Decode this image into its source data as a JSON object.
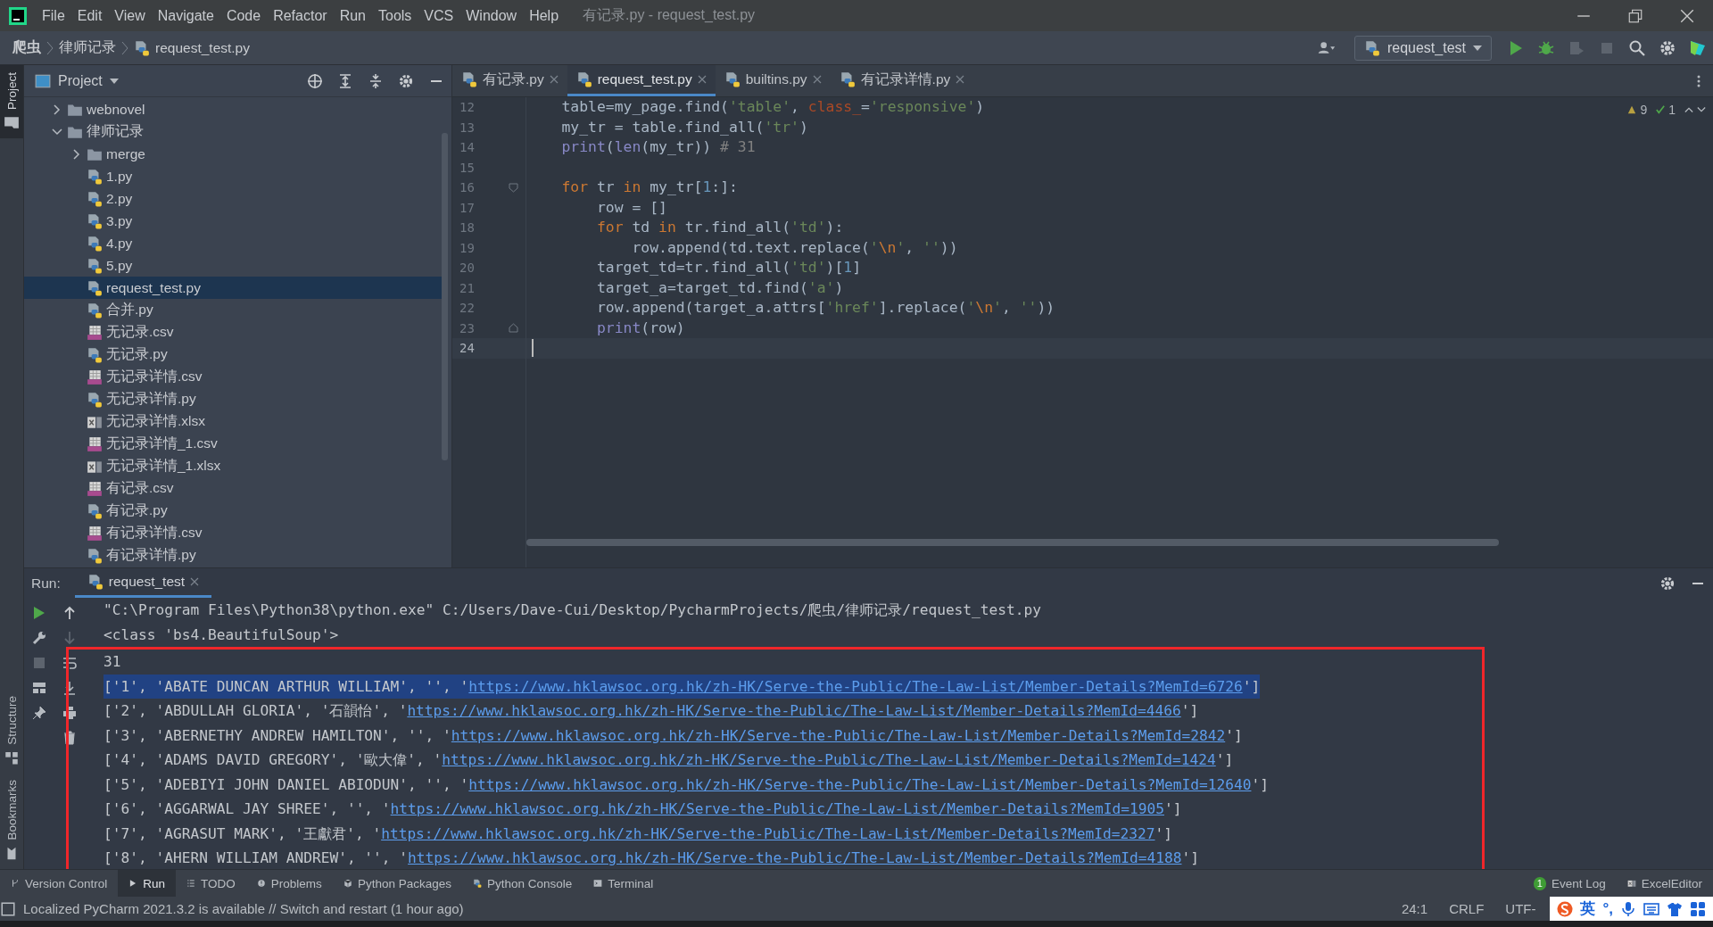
{
  "title_bar": {
    "menu": [
      "File",
      "Edit",
      "View",
      "Navigate",
      "Code",
      "Refactor",
      "Run",
      "Tools",
      "VCS",
      "Window",
      "Help"
    ],
    "title": "有记录.py - request_test.py"
  },
  "nav_bar": {
    "breadcrumbs": [
      "爬虫",
      "律师记录",
      "request_test.py"
    ],
    "run_config": "request_test"
  },
  "side_tabs": [
    {
      "label": "Project",
      "selected": true
    }
  ],
  "bottom_side_tabs": [
    {
      "label": "Structure",
      "selected": false
    },
    {
      "label": "Bookmarks",
      "selected": false
    }
  ],
  "project": {
    "title": "Project",
    "tree": [
      {
        "name": "webnovel",
        "kind": "folder",
        "expanded": false,
        "selected": false
      },
      {
        "name": "律师记录",
        "kind": "folder",
        "expanded": true,
        "selected": false,
        "children": [
          {
            "name": "merge",
            "kind": "folder",
            "expanded": false,
            "selected": false
          },
          {
            "name": "1.py",
            "kind": "python",
            "selected": false
          },
          {
            "name": "2.py",
            "kind": "python",
            "selected": false
          },
          {
            "name": "3.py",
            "kind": "python",
            "selected": false
          },
          {
            "name": "4.py",
            "kind": "python",
            "selected": false
          },
          {
            "name": "5.py",
            "kind": "python",
            "selected": false
          },
          {
            "name": "request_test.py",
            "kind": "python",
            "selected": true
          },
          {
            "name": "合并.py",
            "kind": "python",
            "selected": false
          },
          {
            "name": "无记录.csv",
            "kind": "csv",
            "selected": false
          },
          {
            "name": "无记录.py",
            "kind": "python",
            "selected": false
          },
          {
            "name": "无记录详情.csv",
            "kind": "csv",
            "selected": false
          },
          {
            "name": "无记录详情.py",
            "kind": "python",
            "selected": false
          },
          {
            "name": "无记录详情.xlsx",
            "kind": "excel",
            "selected": false
          },
          {
            "name": "无记录详情_1.csv",
            "kind": "csv",
            "selected": false
          },
          {
            "name": "无记录详情_1.xlsx",
            "kind": "excel",
            "selected": false
          },
          {
            "name": "有记录.csv",
            "kind": "csv",
            "selected": false
          },
          {
            "name": "有记录.py",
            "kind": "python",
            "selected": false
          },
          {
            "name": "有记录详情.csv",
            "kind": "csv",
            "selected": false
          },
          {
            "name": "有记录详情.py",
            "kind": "python",
            "selected": false
          }
        ]
      }
    ]
  },
  "editor": {
    "tabs": [
      {
        "label": "有记录.py",
        "selected": false
      },
      {
        "label": "request_test.py",
        "selected": true
      },
      {
        "label": "builtins.py",
        "selected": false
      },
      {
        "label": "有记录详情.py",
        "selected": false
      }
    ],
    "inspections": {
      "warnings": "9",
      "passed": "1"
    },
    "lines": [
      {
        "number": "12",
        "current": false,
        "tokens": [
          {
            "kind": "plain",
            "text": "table=my_page.find("
          },
          {
            "kind": "string",
            "text": "'table'"
          },
          {
            "kind": "plain",
            "text": ", "
          },
          {
            "kind": "param",
            "text": "class_"
          },
          {
            "kind": "plain",
            "text": "="
          },
          {
            "kind": "string",
            "text": "'responsive'"
          },
          {
            "kind": "plain",
            "text": ")"
          }
        ]
      },
      {
        "number": "13",
        "current": false,
        "tokens": [
          {
            "kind": "plain",
            "text": "my_tr = table.find_all("
          },
          {
            "kind": "string",
            "text": "'tr'"
          },
          {
            "kind": "plain",
            "text": ")"
          }
        ]
      },
      {
        "number": "14",
        "current": false,
        "tokens": [
          {
            "kind": "builtin",
            "text": "print"
          },
          {
            "kind": "plain",
            "text": "("
          },
          {
            "kind": "builtin",
            "text": "len"
          },
          {
            "kind": "plain",
            "text": "(my_tr)) "
          },
          {
            "kind": "comment",
            "text": "# 31"
          }
        ]
      },
      {
        "number": "15",
        "current": false
      },
      {
        "number": "16",
        "current": false,
        "fold_start": true,
        "tokens": [
          {
            "kind": "keyword",
            "text": "for"
          },
          {
            "kind": "plain",
            "text": " tr "
          },
          {
            "kind": "keyword",
            "text": "in"
          },
          {
            "kind": "plain",
            "text": " my_tr["
          },
          {
            "kind": "number",
            "text": "1"
          },
          {
            "kind": "plain",
            "text": ":]:"
          }
        ],
        "children": [
          {
            "number": "17",
            "current": false,
            "tokens": [
              {
                "kind": "plain",
                "text": "row = []"
              }
            ]
          },
          {
            "number": "18",
            "current": false,
            "tokens": [
              {
                "kind": "keyword",
                "text": "for"
              },
              {
                "kind": "plain",
                "text": " td "
              },
              {
                "kind": "keyword",
                "text": "in"
              },
              {
                "kind": "plain",
                "text": " tr.find_all("
              },
              {
                "kind": "string",
                "text": "'td'"
              },
              {
                "kind": "plain",
                "text": "):"
              }
            ],
            "children": [
              {
                "number": "19",
                "current": false,
                "tokens": [
                  {
                    "kind": "plain",
                    "text": "row.append(td.text.replace("
                  },
                  {
                    "kind": "string",
                    "text": "'"
                  },
                  {
                    "kind": "escape",
                    "text": "\\n"
                  },
                  {
                    "kind": "string",
                    "text": "'"
                  },
                  {
                    "kind": "plain",
                    "text": ", "
                  },
                  {
                    "kind": "string",
                    "text": "''"
                  },
                  {
                    "kind": "plain",
                    "text": "))"
                  }
                ]
              }
            ]
          },
          {
            "number": "20",
            "current": false,
            "tokens": [
              {
                "kind": "plain",
                "text": "target_td=tr.find_all("
              },
              {
                "kind": "string",
                "text": "'td'"
              },
              {
                "kind": "plain",
                "text": ")["
              },
              {
                "kind": "number",
                "text": "1"
              },
              {
                "kind": "plain",
                "text": "]"
              }
            ]
          },
          {
            "number": "21",
            "current": false,
            "tokens": [
              {
                "kind": "plain",
                "text": "target_a=target_td.find("
              },
              {
                "kind": "string",
                "text": "'a'"
              },
              {
                "kind": "plain",
                "text": ")"
              }
            ]
          },
          {
            "number": "22",
            "current": false,
            "tokens": [
              {
                "kind": "plain",
                "text": "row.append(target_a.attrs["
              },
              {
                "kind": "string",
                "text": "'href'"
              },
              {
                "kind": "plain",
                "text": "].replace("
              },
              {
                "kind": "string",
                "text": "'"
              },
              {
                "kind": "escape",
                "text": "\\n"
              },
              {
                "kind": "string",
                "text": "'"
              },
              {
                "kind": "plain",
                "text": ", "
              },
              {
                "kind": "string",
                "text": "''"
              },
              {
                "kind": "plain",
                "text": "))"
              }
            ]
          },
          {
            "number": "23",
            "current": false,
            "fold_end": true,
            "tokens": [
              {
                "kind": "builtin",
                "text": "print"
              },
              {
                "kind": "plain",
                "text": "(row)"
              }
            ]
          }
        ]
      },
      {
        "number": "24",
        "current": true
      }
    ]
  },
  "run": {
    "label": "Run:",
    "tab": "request_test",
    "output": [
      {
        "kind": "text",
        "text": "\"C:\\Program Files\\Python38\\python.exe\" C:/Users/Dave-Cui/Desktop/PycharmProjects/爬虫/律师记录/request_test.py"
      },
      {
        "kind": "text",
        "text": "<class 'bs4.BeautifulSoup'>"
      }
    ],
    "boxed_output": [
      {
        "kind": "text",
        "text": "31"
      },
      {
        "kind": "record",
        "selected": true,
        "prefix": "['1', 'ABATE DUNCAN ARTHUR WILLIAM', '', '",
        "link": "https://www.hklawsoc.org.hk/zh-HK/Serve-the-Public/The-Law-List/Member-Details?MemId=6726",
        "suffix": "']"
      },
      {
        "kind": "record",
        "selected": false,
        "prefix": "['2', 'ABDULLAH GLORIA', '石韻怡', '",
        "link": "https://www.hklawsoc.org.hk/zh-HK/Serve-the-Public/The-Law-List/Member-Details?MemId=4466",
        "suffix": "']"
      },
      {
        "kind": "record",
        "selected": false,
        "prefix": "['3', 'ABERNETHY ANDREW HAMILTON', '', '",
        "link": "https://www.hklawsoc.org.hk/zh-HK/Serve-the-Public/The-Law-List/Member-Details?MemId=2842",
        "suffix": "']"
      },
      {
        "kind": "record",
        "selected": false,
        "prefix": "['4', 'ADAMS DAVID GREGORY', '歐大偉', '",
        "link": "https://www.hklawsoc.org.hk/zh-HK/Serve-the-Public/The-Law-List/Member-Details?MemId=1424",
        "suffix": "']"
      },
      {
        "kind": "record",
        "selected": false,
        "prefix": "['5', 'ADEBIYI JOHN DANIEL ABIODUN', '', '",
        "link": "https://www.hklawsoc.org.hk/zh-HK/Serve-the-Public/The-Law-List/Member-Details?MemId=12640",
        "suffix": "']"
      },
      {
        "kind": "record",
        "selected": false,
        "prefix": "['6', 'AGGARWAL JAY SHREE', '', '",
        "link": "https://www.hklawsoc.org.hk/zh-HK/Serve-the-Public/The-Law-List/Member-Details?MemId=1905",
        "suffix": "']"
      },
      {
        "kind": "record",
        "selected": false,
        "prefix": "['7', 'AGRASUT MARK', '王獻君', '",
        "link": "https://www.hklawsoc.org.hk/zh-HK/Serve-the-Public/The-Law-List/Member-Details?MemId=2327",
        "suffix": "']"
      },
      {
        "kind": "record",
        "selected": false,
        "prefix": "['8', 'AHERN WILLIAM ANDREW', '', '",
        "link": "https://www.hklawsoc.org.hk/zh-HK/Serve-the-Public/The-Law-List/Member-Details?MemId=4188",
        "suffix": "']"
      }
    ]
  },
  "tool_windows": [
    {
      "label": "Version Control",
      "kind": "vcs",
      "selected": false
    },
    {
      "label": "Run",
      "kind": "run",
      "selected": true
    },
    {
      "label": "TODO",
      "kind": "todo",
      "selected": false
    },
    {
      "label": "Problems",
      "kind": "problems",
      "selected": false
    },
    {
      "label": "Python Packages",
      "kind": "packages",
      "selected": false
    },
    {
      "label": "Python Console",
      "kind": "console",
      "selected": false
    },
    {
      "label": "Terminal",
      "kind": "terminal",
      "selected": false
    }
  ],
  "tool_windows_right": [
    {
      "label": "Event Log",
      "badge": "1"
    },
    {
      "label": "ExcelEditor",
      "kind": "excel"
    }
  ],
  "status_bar": {
    "message": "Localized PyCharm 2021.3.2 is available // Switch and restart (1 hour ago)",
    "position": "24:1",
    "line_separator": "CRLF",
    "encoding": "UTF-"
  },
  "ime": {
    "mode": "英",
    "punctuation": "°,"
  }
}
